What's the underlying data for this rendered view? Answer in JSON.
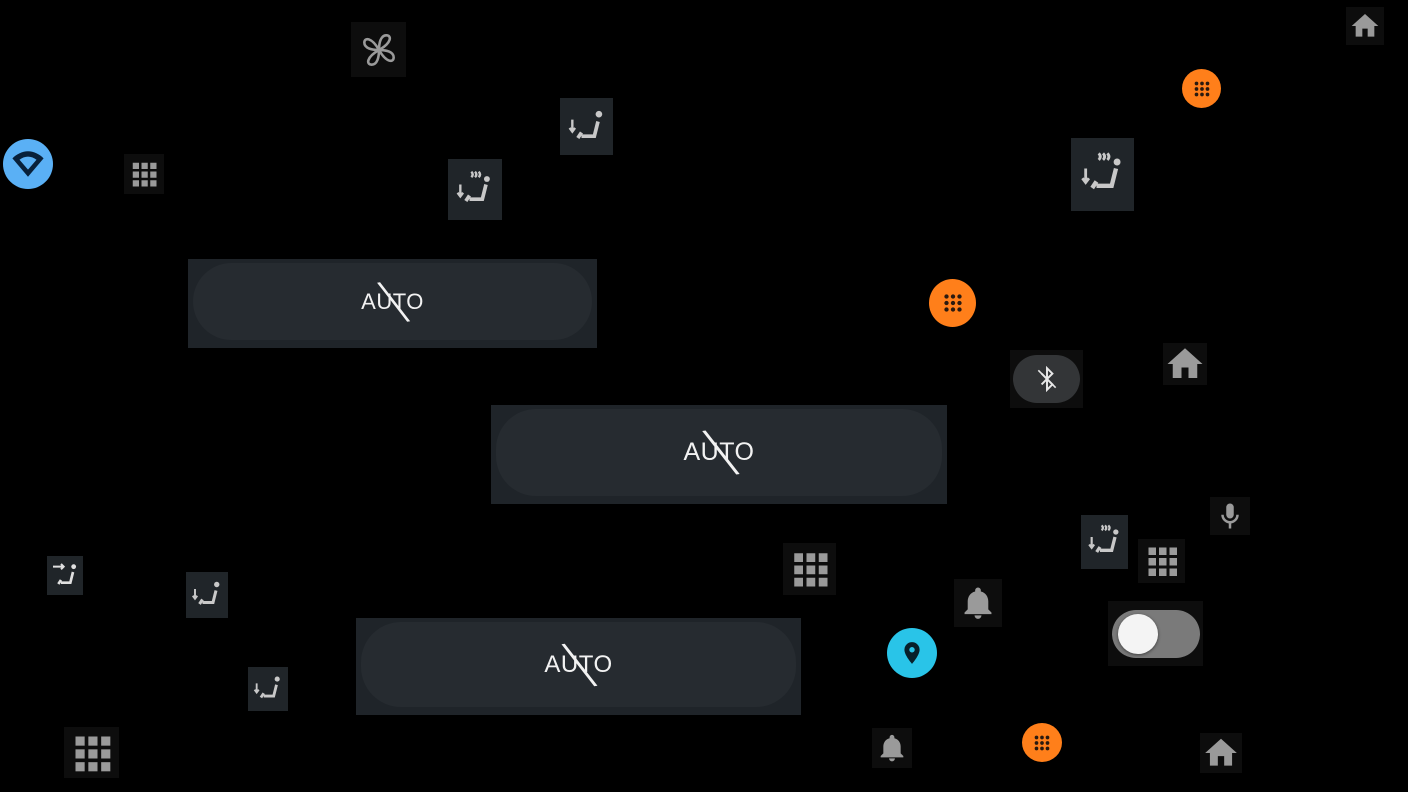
{
  "hvac": {
    "auto_buttons": [
      {
        "label": "AUTO",
        "state": "off"
      },
      {
        "label": "AUTO",
        "state": "off"
      },
      {
        "label": "AUTO",
        "state": "off"
      }
    ],
    "toggle": {
      "state": "off"
    }
  },
  "icons": [
    "fan-icon",
    "seat-heat-icon",
    "seat-cool-icon",
    "seat-recline-icon",
    "apps-grid-icon",
    "home-icon",
    "bluetooth-icon",
    "microphone-icon",
    "bell-icon",
    "location-pin-icon",
    "wifi-icon"
  ],
  "colors": {
    "background": "#000000",
    "tile": "#202529",
    "orange": "#ff7f1a",
    "blue": "#5ab0f5",
    "cyan": "#29c4e8",
    "icon_gray": "#9a9a9a"
  }
}
